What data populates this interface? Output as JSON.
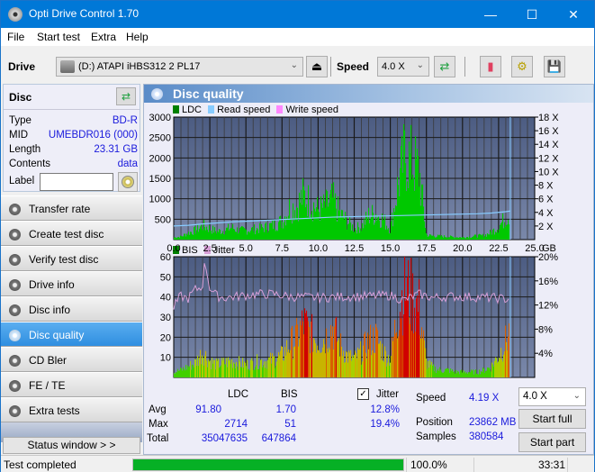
{
  "window": {
    "title": "Opti Drive Control 1.70",
    "minimize": "—",
    "maximize": "☐",
    "close": "✕"
  },
  "menu": [
    "File",
    "Start test",
    "Extra",
    "Help"
  ],
  "toolbar": {
    "drive_label": "Drive",
    "drive_value": "(D:)   ATAPI iHBS312   2 PL17",
    "speed_label": "Speed",
    "speed_value": "4.0 X",
    "icons": [
      "eject-icon",
      "refresh-icon",
      "erase-icon",
      "settings-icon",
      "save-icon"
    ]
  },
  "disc": {
    "header": "Disc",
    "fields": [
      {
        "key": "Type",
        "value": "BD-R"
      },
      {
        "key": "MID",
        "value": "UMEBDR016 (000)"
      },
      {
        "key": "Length",
        "value": "23.31 GB"
      },
      {
        "key": "Contents",
        "value": "data"
      }
    ],
    "label_key": "Label",
    "label_value": ""
  },
  "nav": [
    {
      "label": "Transfer rate",
      "active": false
    },
    {
      "label": "Create test disc",
      "active": false
    },
    {
      "label": "Verify test disc",
      "active": false
    },
    {
      "label": "Drive info",
      "active": false
    },
    {
      "label": "Disc info",
      "active": false
    },
    {
      "label": "Disc quality",
      "active": true
    },
    {
      "label": "CD Bler",
      "active": false
    },
    {
      "label": "FE / TE",
      "active": false
    },
    {
      "label": "Extra tests",
      "active": false
    }
  ],
  "status_window_btn": "Status window > >",
  "main": {
    "title": "Disc quality"
  },
  "chart_data": [
    {
      "type": "area",
      "title": "LDC",
      "legend": [
        {
          "name": "LDC",
          "color": "#008000"
        },
        {
          "name": "Read speed",
          "color": "#88ccff"
        },
        {
          "name": "Write speed",
          "color": "#ff88ff"
        }
      ],
      "xlabel": "GB",
      "xlim": [
        0,
        25
      ],
      "xticks": [
        "0.0",
        "2.5",
        "5.0",
        "7.5",
        "10.0",
        "12.5",
        "15.0",
        "17.5",
        "20.0",
        "22.5",
        "25.0"
      ],
      "ylim": [
        0,
        3000
      ],
      "yticks": [
        "500",
        "1000",
        "1500",
        "2000",
        "2500",
        "3000"
      ],
      "y2lim": [
        0,
        18
      ],
      "y2ticks": [
        "2 X",
        "4 X",
        "6 X",
        "8 X",
        "10 X",
        "12 X",
        "14 X",
        "16 X",
        "18 X"
      ],
      "grid": true,
      "series": [
        {
          "name": "LDC",
          "x": [
            0.0,
            0.5,
            1.0,
            1.5,
            2.0,
            2.5,
            3.0,
            3.5,
            4.0,
            4.5,
            5.0,
            5.5,
            6.0,
            6.5,
            7.0,
            7.5,
            8.0,
            8.5,
            9.0,
            9.5,
            10.0,
            10.5,
            11.0,
            11.5,
            12.0,
            12.5,
            13.0,
            13.5,
            14.0,
            14.5,
            15.0,
            15.5,
            16.0,
            16.5,
            17.0,
            17.5,
            18.0,
            18.5,
            19.0,
            19.5,
            20.0,
            20.5,
            21.0,
            21.5,
            22.0,
            22.5,
            23.0,
            23.31
          ],
          "values": [
            60,
            80,
            180,
            250,
            380,
            300,
            220,
            250,
            330,
            250,
            250,
            280,
            300,
            350,
            420,
            500,
            850,
            900,
            1200,
            1000,
            800,
            900,
            1100,
            700,
            500,
            300,
            350,
            650,
            700,
            550,
            280,
            1400,
            2300,
            2100,
            1850,
            120,
            100,
            90,
            80,
            70,
            60,
            80,
            100,
            110,
            200,
            350,
            600,
            700
          ]
        },
        {
          "name": "Read speed",
          "x": [
            0.0,
            1.0,
            2.0,
            3.0,
            4.0,
            5.0,
            6.0,
            7.0,
            8.0,
            9.0,
            10.0,
            11.0,
            12.0,
            13.0,
            14.0,
            15.0,
            16.0,
            17.0,
            18.0,
            19.0,
            20.0,
            21.0,
            22.0,
            23.0,
            23.31
          ],
          "values": [
            2.0,
            2.1,
            2.3,
            2.45,
            2.6,
            2.7,
            2.8,
            2.9,
            3.0,
            3.1,
            3.2,
            3.3,
            3.35,
            3.4,
            3.45,
            3.5,
            3.55,
            3.6,
            3.65,
            3.7,
            3.75,
            3.8,
            3.9,
            4.1,
            4.2
          ]
        }
      ]
    },
    {
      "type": "bar",
      "title": "BIS / Jitter",
      "legend": [
        {
          "name": "BIS",
          "color": "#008000"
        },
        {
          "name": "Jitter",
          "color": "#d8a0d8"
        }
      ],
      "xlabel": "GB",
      "xlim": [
        0,
        25
      ],
      "xticks": [
        "0.0",
        "2.5",
        "5.0",
        "7.5",
        "10.0",
        "12.5",
        "15.0",
        "17.5",
        "20.0",
        "22.5",
        "25.0"
      ],
      "ylim": [
        0,
        60
      ],
      "yticks": [
        "10",
        "20",
        "30",
        "40",
        "50",
        "60"
      ],
      "y2lim": [
        0,
        20
      ],
      "y2ticks": [
        "4%",
        "8%",
        "12%",
        "16%",
        "20%"
      ],
      "grid": true,
      "series": [
        {
          "name": "BIS",
          "x": [
            0.0,
            0.5,
            1.0,
            1.5,
            2.0,
            2.5,
            3.0,
            3.5,
            4.0,
            4.5,
            5.0,
            5.5,
            6.0,
            6.5,
            7.0,
            7.5,
            8.0,
            8.5,
            9.0,
            9.5,
            10.0,
            10.5,
            11.0,
            11.5,
            12.0,
            12.5,
            13.0,
            13.5,
            14.0,
            14.5,
            15.0,
            15.5,
            16.0,
            16.5,
            17.0,
            17.5,
            18.0,
            18.5,
            19.0,
            19.5,
            20.0,
            20.5,
            21.0,
            21.5,
            22.0,
            22.5,
            23.0,
            23.31
          ],
          "values": [
            3,
            4,
            6,
            8,
            14,
            9,
            7,
            8,
            9,
            8,
            7,
            8,
            9,
            9,
            10,
            12,
            18,
            22,
            30,
            24,
            20,
            22,
            28,
            18,
            12,
            10,
            14,
            20,
            22,
            14,
            10,
            35,
            50,
            44,
            38,
            8,
            5,
            4,
            4,
            3,
            3,
            3,
            3,
            4,
            6,
            12,
            20,
            26
          ]
        },
        {
          "name": "Jitter",
          "x": [
            0.0,
            0.5,
            1.0,
            1.5,
            2.0,
            2.2,
            2.5,
            3.0,
            3.5,
            4.0,
            5.0,
            6.0,
            7.0,
            8.0,
            9.0,
            10.0,
            11.0,
            12.0,
            13.0,
            14.0,
            15.0,
            16.0,
            17.0,
            18.0,
            19.0,
            20.0,
            21.0,
            22.0,
            23.0,
            23.31
          ],
          "values": [
            11.5,
            13.5,
            13.0,
            14.5,
            15.0,
            19.4,
            15.0,
            13.5,
            13.2,
            13.3,
            13.6,
            13.8,
            13.8,
            13.4,
            13.3,
            13.2,
            13.3,
            13.4,
            13.4,
            13.5,
            13.6,
            12.8,
            13.8,
            13.2,
            13.4,
            13.4,
            13.3,
            13.2,
            13.0,
            13.0
          ]
        }
      ]
    }
  ],
  "stats": {
    "col_ldc": "LDC",
    "col_bis": "BIS",
    "jitter_label": "Jitter",
    "jitter_checked": true,
    "rows": [
      {
        "label": "Avg",
        "ldc": "91.80",
        "bis": "1.70",
        "jitter": "12.8%"
      },
      {
        "label": "Max",
        "ldc": "2714",
        "bis": "51",
        "jitter": "19.4%"
      },
      {
        "label": "Total",
        "ldc": "35047635",
        "bis": "647864",
        "jitter": ""
      }
    ],
    "speed_label": "Speed",
    "speed_value": "4.19 X",
    "position_label": "Position",
    "position_value": "23862 MB",
    "samples_label": "Samples",
    "samples_value": "380584",
    "speed_select": "4.0 X",
    "start_full": "Start full",
    "start_part": "Start part"
  },
  "statusbar": {
    "text": "Test completed",
    "progress": 100.0,
    "progress_text": "100.0%",
    "time": "33:31"
  }
}
